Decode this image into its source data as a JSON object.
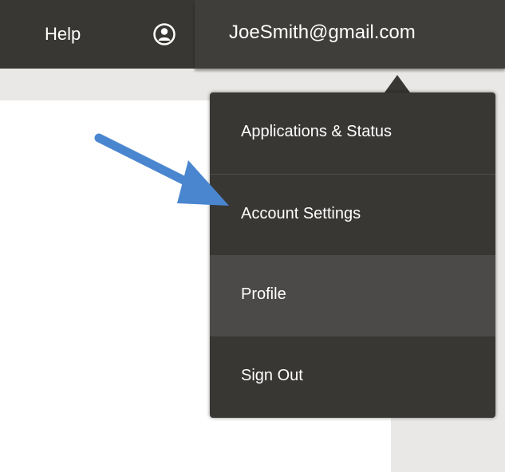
{
  "header": {
    "help_label": "Help",
    "user_icon": "user-circle-icon",
    "account_email": "JoeSmith@gmail.com"
  },
  "account_menu": {
    "items": [
      {
        "label": "Applications & Status"
      },
      {
        "label": "Account Settings"
      },
      {
        "label": "Profile",
        "highlighted": true
      },
      {
        "label": "Sign Out"
      }
    ]
  },
  "annotation": {
    "arrow_color": "#4a86d0",
    "arrow_icon": "arrow-right-icon",
    "points_to": "Account Settings"
  },
  "colors": {
    "topbar": "#383734",
    "menu_background": "#383734",
    "menu_highlight": "#4c4a48",
    "page_background": "#eae8e6"
  }
}
